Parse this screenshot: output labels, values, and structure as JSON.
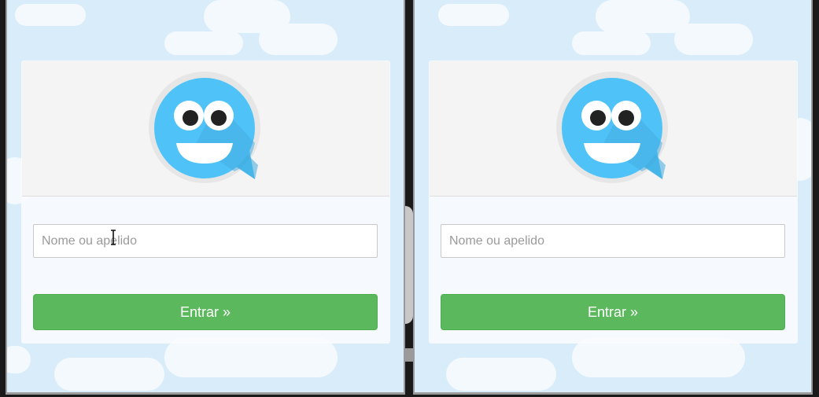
{
  "windows": [
    {
      "login": {
        "name_placeholder": "Nome ou apelido",
        "enter_label": "Entrar »"
      }
    },
    {
      "login": {
        "name_placeholder": "Nome ou apelido",
        "enter_label": "Entrar »"
      }
    }
  ],
  "colors": {
    "sky": "#d8ecfa",
    "button": "#5cb85c",
    "logo_bubble": "#4fc3f7"
  },
  "icons": [
    "chat-bubble-smiley-icon",
    "text-cursor-icon"
  ]
}
